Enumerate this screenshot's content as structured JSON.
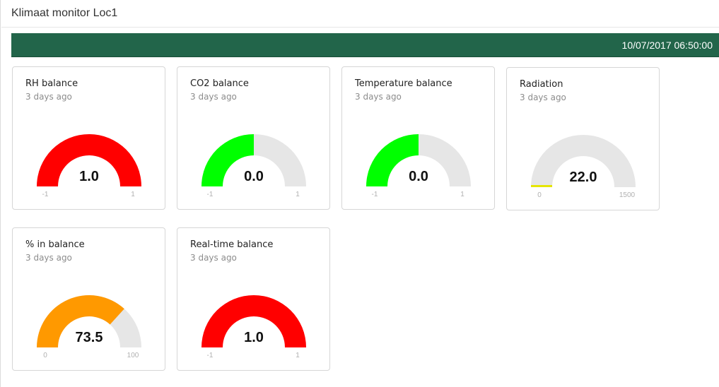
{
  "header": {
    "title": "Klimaat monitor Loc1",
    "timestamp": "10/07/2017 06:50:00"
  },
  "colors": {
    "header_bar": "#22654a",
    "gauge_track": "#e6e6e6",
    "red": "#ff0000",
    "green": "#00ff00",
    "orange": "#ff9900",
    "yellow": "#e6e600"
  },
  "widgets": [
    {
      "title": "RH balance",
      "subtitle": "3 days ago",
      "value": "1.0",
      "min": "-1",
      "max": "1",
      "color": "#ff0000",
      "fraction": 1.0
    },
    {
      "title": "CO2 balance",
      "subtitle": "3 days ago",
      "value": "0.0",
      "min": "-1",
      "max": "1",
      "color": "#00ff00",
      "fraction": 0.5
    },
    {
      "title": "Temperature balance",
      "subtitle": "3 days ago",
      "value": "0.0",
      "min": "-1",
      "max": "1",
      "color": "#00ff00",
      "fraction": 0.5
    },
    {
      "title": "Radiation",
      "subtitle": "3 days ago",
      "value": "22.0",
      "min": "0",
      "max": "1500",
      "color": "#e6e600",
      "fraction": 0.0147
    },
    {
      "title": "% in balance",
      "subtitle": "3 days ago",
      "value": "73.5",
      "min": "0",
      "max": "100",
      "color": "#ff9900",
      "fraction": 0.735
    },
    {
      "title": "Real-time balance",
      "subtitle": "3 days ago",
      "value": "1.0",
      "min": "-1",
      "max": "1",
      "color": "#ff0000",
      "fraction": 1.0
    }
  ]
}
